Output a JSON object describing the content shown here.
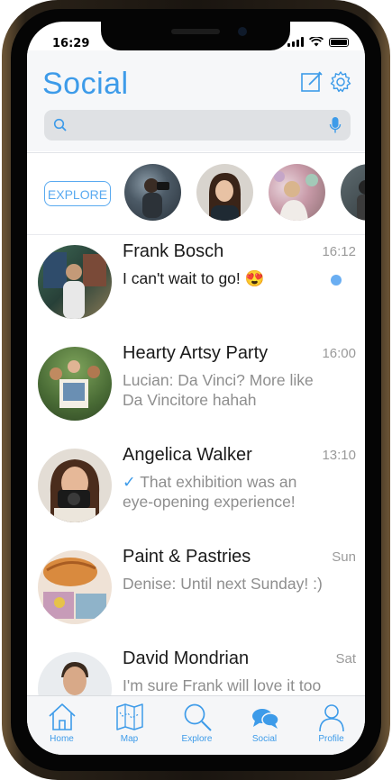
{
  "status": {
    "time": "16:29"
  },
  "header": {
    "title": "Social",
    "search_placeholder": ""
  },
  "stories": {
    "explore_label": "EXPLORE"
  },
  "chats": [
    {
      "name": "Frank Bosch",
      "time": "16:12",
      "preview": "I can't wait to go! 😍",
      "unread": true
    },
    {
      "name": "Hearty Artsy Party",
      "time": "16:00",
      "preview": "Lucian: Da Vinci? More like Da Vincitore hahah"
    },
    {
      "name": "Angelica Walker",
      "time": "13:10",
      "check": "✓",
      "preview": "That exhibition was an eye-opening experience!"
    },
    {
      "name": "Paint & Pastries",
      "time": "Sun",
      "preview": "Denise: Until next Sunday! :)"
    },
    {
      "name": "David Mondrian",
      "time": "Sat",
      "preview": "I'm sure Frank will love it too"
    }
  ],
  "tabs": [
    {
      "label": "Home",
      "icon": "home-icon"
    },
    {
      "label": "Map",
      "icon": "map-icon"
    },
    {
      "label": "Explore",
      "icon": "search-icon"
    },
    {
      "label": "Social",
      "icon": "chat-bubbles-icon"
    },
    {
      "label": "Profile",
      "icon": "profile-icon"
    }
  ],
  "colors": {
    "accent": "#3d9be9",
    "unread": "#6aaef2"
  }
}
